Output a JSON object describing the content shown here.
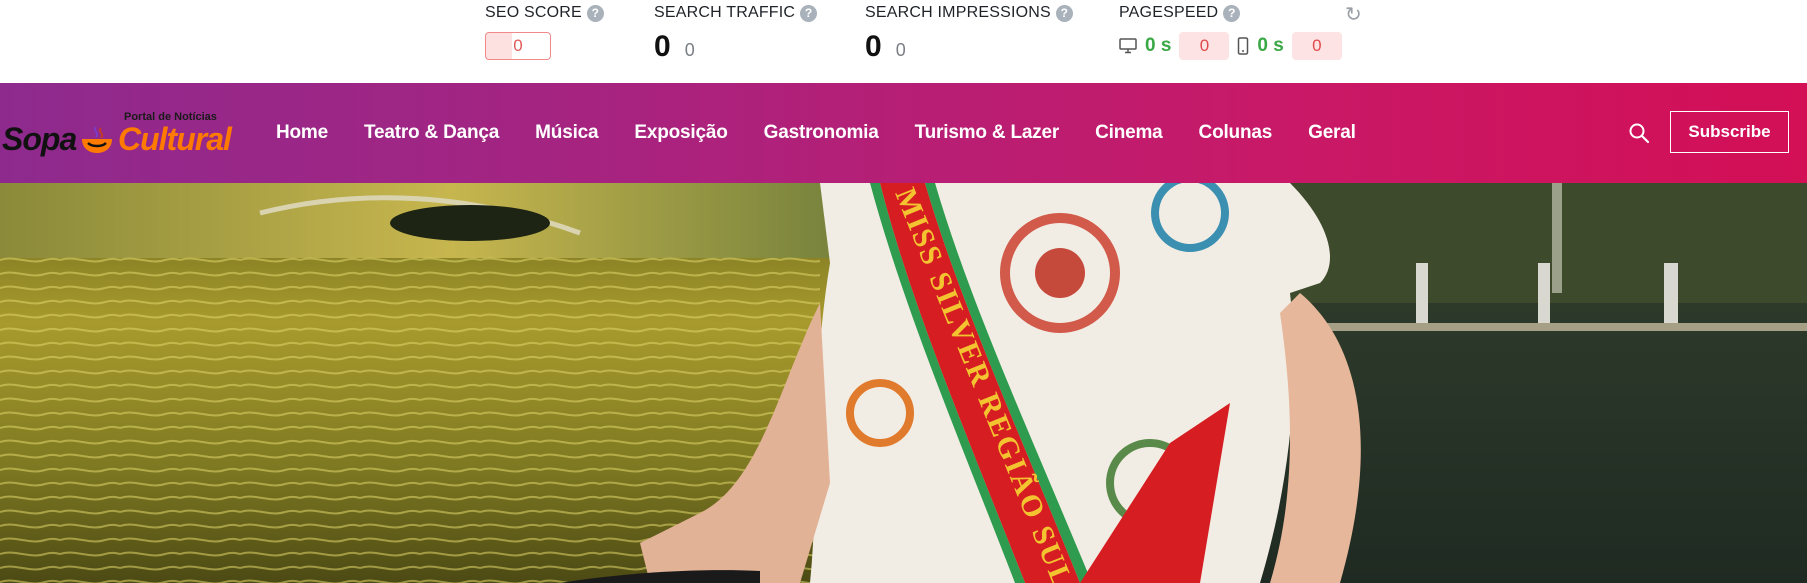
{
  "seo": {
    "seo_score": {
      "label": "SEO SCORE",
      "value": "0"
    },
    "search_traffic": {
      "label": "SEARCH TRAFFIC",
      "value": "0",
      "change": "0"
    },
    "search_impressions": {
      "label": "SEARCH IMPRESSIONS",
      "value": "0",
      "change": "0"
    },
    "pagespeed": {
      "label": "PAGESPEED",
      "desktop": {
        "time": "0 s",
        "score": "0"
      },
      "mobile": {
        "time": "0 s",
        "score": "0"
      }
    },
    "help_glyph": "?"
  },
  "logo": {
    "brand_left": "Sopa",
    "brand_right": "Cultural",
    "tagline": "Portal de Notícias"
  },
  "nav": {
    "items": [
      "Home",
      "Teatro & Dança",
      "Música",
      "Exposição",
      "Gastronomia",
      "Turismo & Lazer",
      "Cinema",
      "Colunas",
      "Geral"
    ],
    "subscribe_label": "Subscribe"
  },
  "hero": {
    "sash_text": "MISS SILVER REGIÃO SUL"
  },
  "colors": {
    "nav_start": "#8e2a8e",
    "nav_end": "#d30f56",
    "brand_orange": "#ff7a00",
    "good": "#3aa845",
    "bad": "#e14a4a"
  }
}
